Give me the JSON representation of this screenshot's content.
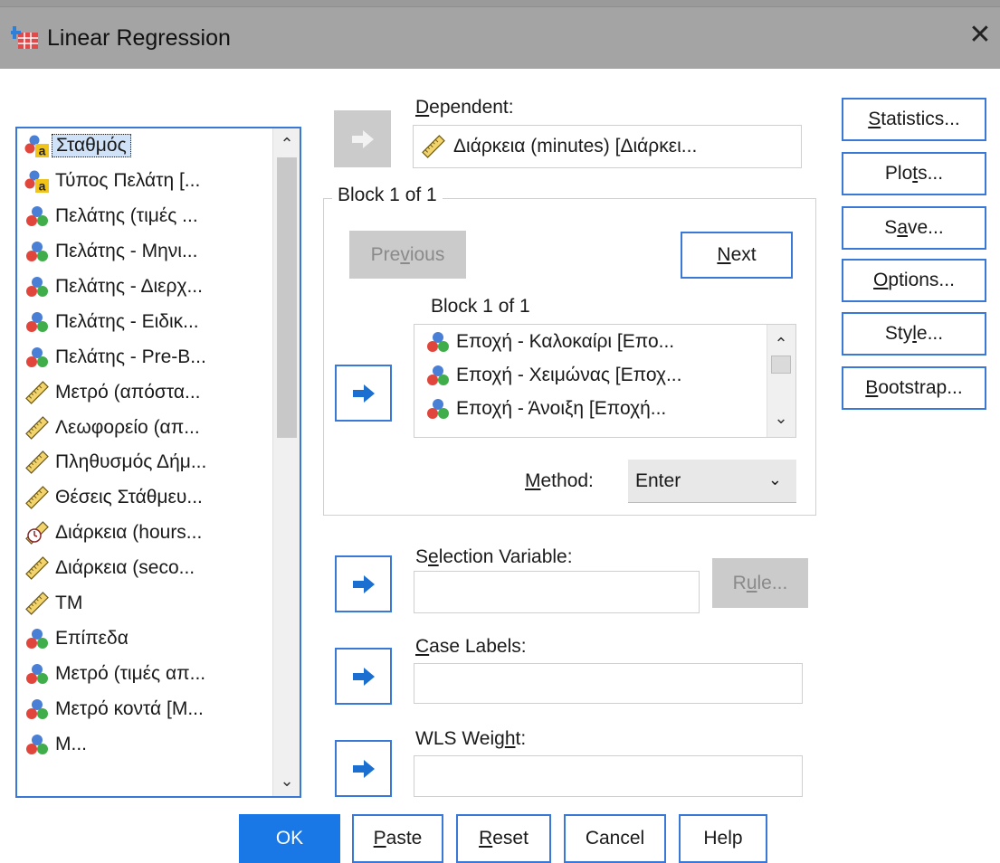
{
  "window": {
    "title": "Linear Regression",
    "close_glyph": "✕"
  },
  "variables": {
    "items": [
      {
        "label": "Σταθμός",
        "icon": "nominal-string-icon",
        "selected": true
      },
      {
        "label": "Τύπος Πελάτη [...",
        "icon": "nominal-string-icon"
      },
      {
        "label": "Πελάτης (τιμές ...",
        "icon": "nominal-icon"
      },
      {
        "label": "Πελάτης - Μηνι...",
        "icon": "nominal-icon"
      },
      {
        "label": "Πελάτης - Διερχ...",
        "icon": "nominal-icon"
      },
      {
        "label": "Πελάτης - Ειδικ...",
        "icon": "nominal-icon"
      },
      {
        "label": "Πελάτης - Pre-B...",
        "icon": "nominal-icon"
      },
      {
        "label": "Μετρό (απόστα...",
        "icon": "scale-icon"
      },
      {
        "label": "Λεωφορείο (απ...",
        "icon": "scale-icon"
      },
      {
        "label": "Πληθυσμός Δήμ...",
        "icon": "scale-icon"
      },
      {
        "label": "Θέσεις Στάθμευ...",
        "icon": "scale-icon"
      },
      {
        "label": "Διάρκεια (hours...",
        "icon": "time-scale-icon"
      },
      {
        "label": "Διάρκεια (seco...",
        "icon": "scale-icon"
      },
      {
        "label": "TM",
        "icon": "scale-icon"
      },
      {
        "label": "Επίπεδα",
        "icon": "nominal-icon"
      },
      {
        "label": "Μετρό (τιμές απ...",
        "icon": "nominal-icon"
      },
      {
        "label": "Μετρό κοντά [Μ...",
        "icon": "nominal-icon"
      },
      {
        "label": "Μ...",
        "icon": "nominal-icon"
      }
    ]
  },
  "dependent": {
    "label_pre": "",
    "label_u": "D",
    "label_post": "ependent:",
    "value": "Διάρκεια (minutes) [Διάρκει..."
  },
  "block": {
    "group_title": "Block 1 of 1",
    "inner_title": "Block 1 of 1",
    "previous_pre": "Pre",
    "previous_u": "v",
    "previous_post": "ious",
    "next_u": "N",
    "next_post": "ext",
    "independents": [
      {
        "label": "Εποχή - Καλοκαίρι [Επο...",
        "icon": "nominal-icon"
      },
      {
        "label": "Εποχή - Χειμώνας [Εποχ...",
        "icon": "nominal-icon"
      },
      {
        "label": "Εποχή - Άνοιξη [Εποχή...",
        "icon": "nominal-icon"
      }
    ]
  },
  "method": {
    "label_u": "M",
    "label_post": "ethod:",
    "value": "Enter",
    "chevron": "⌄"
  },
  "selection_variable": {
    "label_pre": "S",
    "label_u": "e",
    "label_post": "lection Variable:",
    "value": "",
    "rule_pre": "R",
    "rule_u": "u",
    "rule_post": "le..."
  },
  "case_labels": {
    "label_u": "C",
    "label_post": "ase Labels:",
    "value": ""
  },
  "wls_weight": {
    "label_pre": "WLS Weig",
    "label_u": "h",
    "label_post": "t:",
    "value": ""
  },
  "side_buttons": [
    {
      "pre": "",
      "u": "S",
      "post": "tatistics..."
    },
    {
      "pre": "Plo",
      "u": "t",
      "post": "s..."
    },
    {
      "pre": "S",
      "u": "a",
      "post": "ve..."
    },
    {
      "pre": "",
      "u": "O",
      "post": "ptions..."
    },
    {
      "pre": "Sty",
      "u": "l",
      "post": "e..."
    },
    {
      "pre": "",
      "u": "B",
      "post": "ootstrap..."
    }
  ],
  "bottom_buttons": {
    "ok": "OK",
    "paste_u": "P",
    "paste_post": "aste",
    "reset_u": "R",
    "reset_post": "eset",
    "cancel": "Cancel",
    "help": "Help"
  },
  "colors": {
    "accent": "#3a78d8",
    "primary_button": "#1a78e6",
    "title_bar": "#a4a4a4",
    "disabled": "#cbcbcb"
  }
}
